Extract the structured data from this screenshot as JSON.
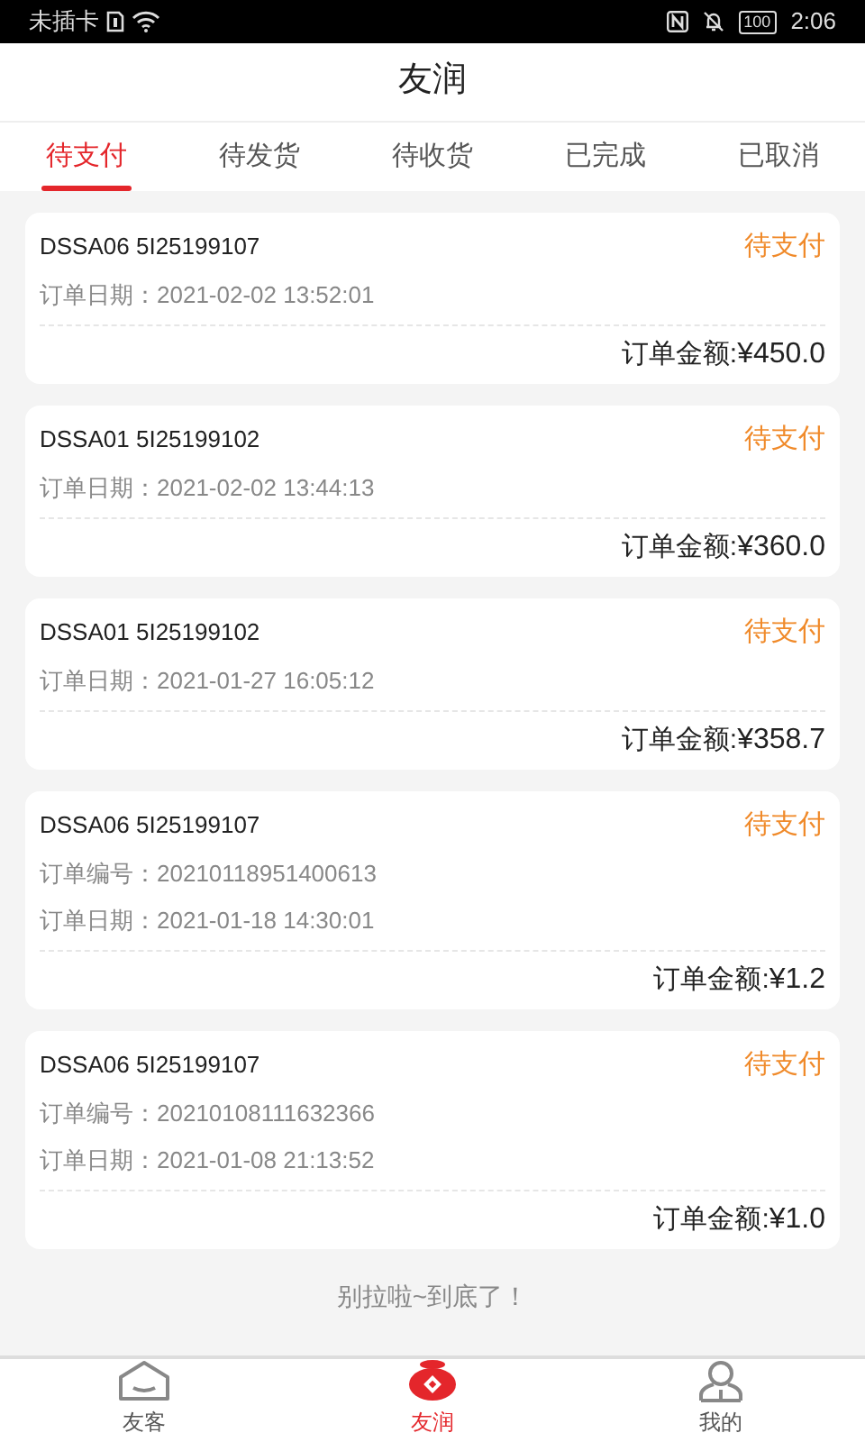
{
  "status_bar": {
    "carrier": "未插卡",
    "battery": "100",
    "time": "2:06"
  },
  "header": {
    "title": "友润"
  },
  "tabs": [
    {
      "label": "待支付",
      "selected": true
    },
    {
      "label": "待发货",
      "selected": false
    },
    {
      "label": "待收货",
      "selected": false
    },
    {
      "label": "已完成",
      "selected": false
    },
    {
      "label": "已取消",
      "selected": false
    }
  ],
  "orders": [
    {
      "code": "DSSA06 5I25199107",
      "status": "待支付",
      "fields": [
        {
          "label": "订单日期：",
          "value": "2021-02-02 13:52:01"
        }
      ],
      "amount_label": "订单金额:",
      "amount": "¥450.0"
    },
    {
      "code": "DSSA01 5I25199102",
      "status": "待支付",
      "fields": [
        {
          "label": "订单日期：",
          "value": "2021-02-02 13:44:13"
        }
      ],
      "amount_label": "订单金额:",
      "amount": "¥360.0"
    },
    {
      "code": "DSSA01 5I25199102",
      "status": "待支付",
      "fields": [
        {
          "label": "订单日期：",
          "value": "2021-01-27 16:05:12"
        }
      ],
      "amount_label": "订单金额:",
      "amount": "¥358.7"
    },
    {
      "code": "DSSA06 5I25199107",
      "status": "待支付",
      "fields": [
        {
          "label": "订单编号：",
          "value": "20210118951400613"
        },
        {
          "label": "订单日期：",
          "value": "2021-01-18 14:30:01"
        }
      ],
      "amount_label": "订单金额:",
      "amount": "¥1.2"
    },
    {
      "code": "DSSA06 5I25199107",
      "status": "待支付",
      "fields": [
        {
          "label": "订单编号：",
          "value": "20210108111632366"
        },
        {
          "label": "订单日期：",
          "value": "2021-01-08 21:13:52"
        }
      ],
      "amount_label": "订单金额:",
      "amount": "¥1.0"
    }
  ],
  "end_text": "别拉啦~到底了！",
  "bottom_nav": [
    {
      "label": "友客",
      "kind": "home",
      "selected": false
    },
    {
      "label": "友润",
      "kind": "jar",
      "selected": true
    },
    {
      "label": "我的",
      "kind": "person",
      "selected": false
    }
  ]
}
